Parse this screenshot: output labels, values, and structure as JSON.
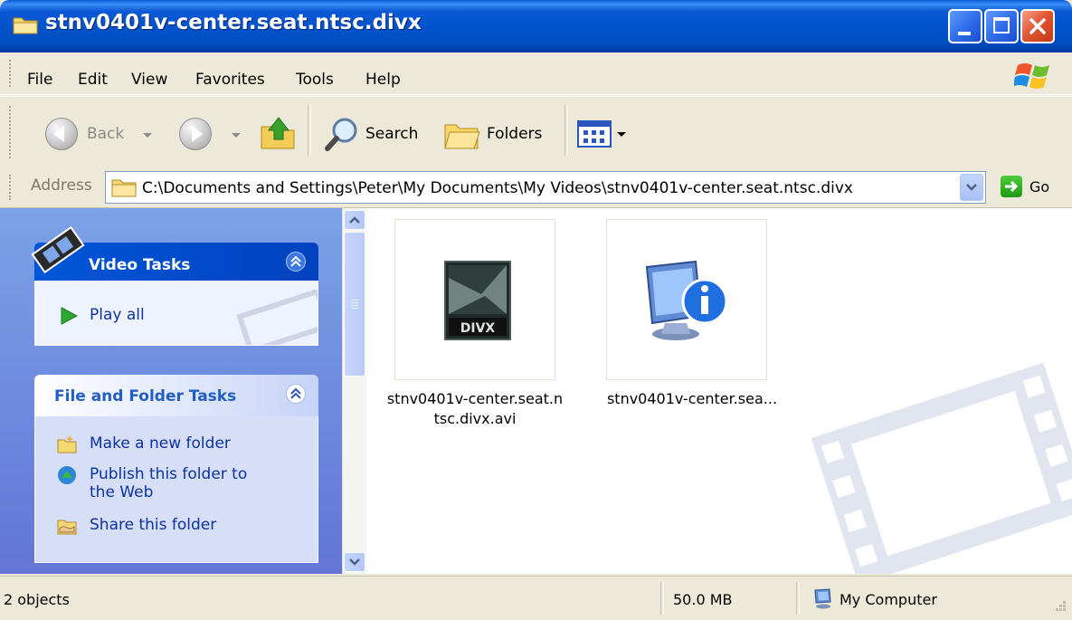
{
  "window": {
    "title": "stnv0401v-center.seat.ntsc.divx"
  },
  "menu": [
    "File",
    "Edit",
    "View",
    "Favorites",
    "Tools",
    "Help"
  ],
  "toolbar": {
    "back": "Back",
    "search": "Search",
    "folders": "Folders"
  },
  "address": {
    "label": "Address",
    "path": "C:\\Documents and Settings\\Peter\\My Documents\\My Videos\\stnv0401v-center.seat.ntsc.divx",
    "go": "Go"
  },
  "tasks": {
    "video": {
      "title": "Video Tasks",
      "items": [
        "Play all"
      ]
    },
    "file_folder": {
      "title": "File and Folder Tasks",
      "items": [
        "Make a new folder",
        "Publish this folder to",
        "the Web",
        "Share this folder"
      ]
    }
  },
  "files": [
    {
      "line1": "stnv0401v-center.seat.n",
      "line2": "tsc.divx.avi",
      "icon": "divx-video-icon"
    },
    {
      "line1": "stnv0401v-center.sea...",
      "line2": "",
      "icon": "computer-info-icon"
    }
  ],
  "status": {
    "objects": "2 objects",
    "size": "50.0 MB",
    "zone": "My Computer"
  }
}
